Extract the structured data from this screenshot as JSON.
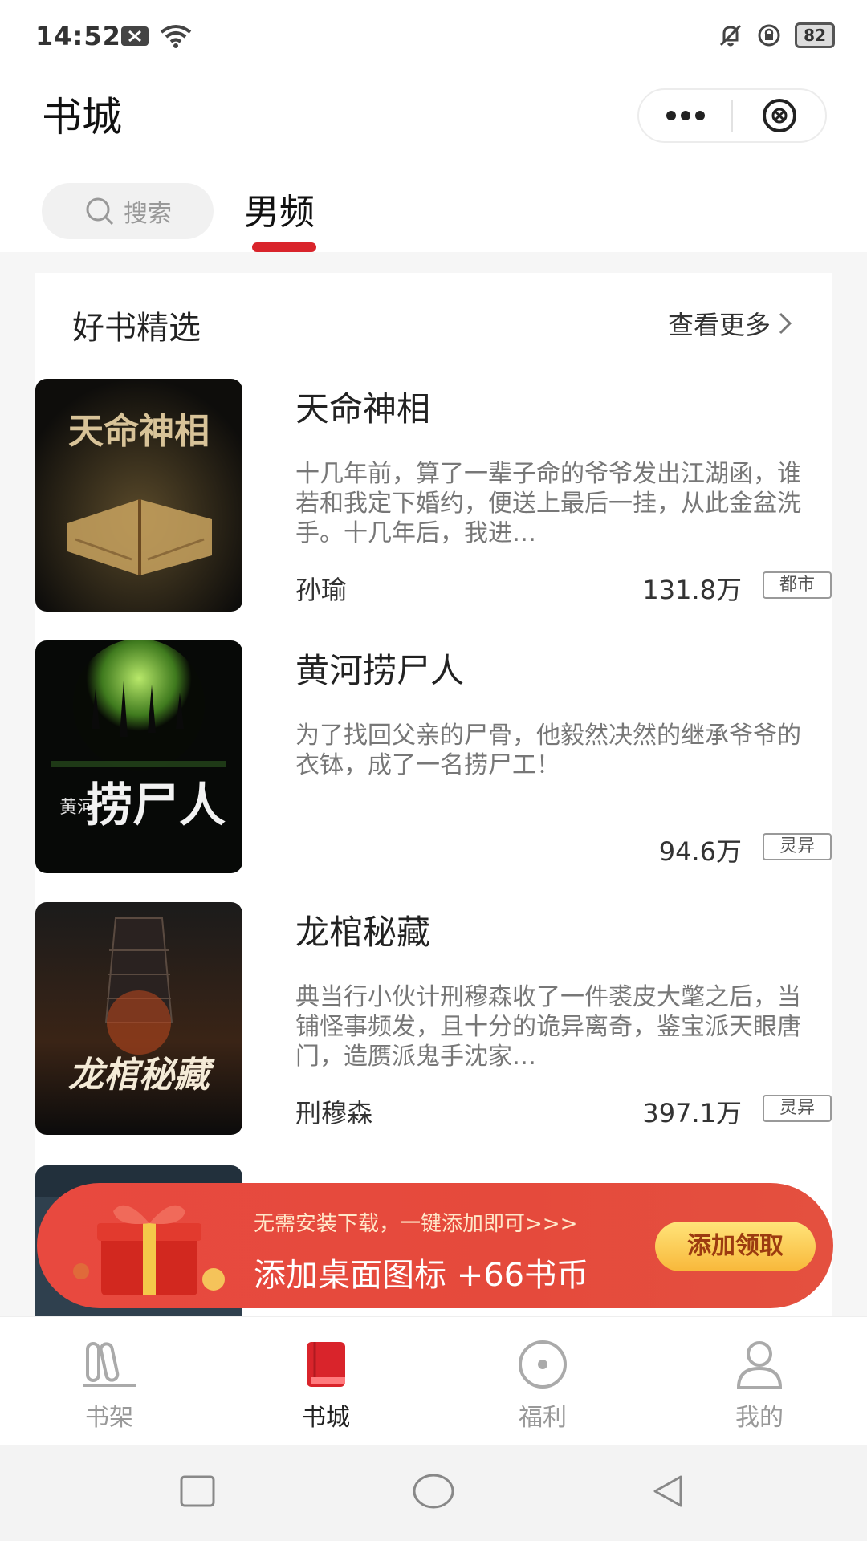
{
  "status_bar": {
    "time": "14:52",
    "battery": "82"
  },
  "header": {
    "title": "书城"
  },
  "tabs": {
    "search_placeholder": "搜索",
    "active_tab": "男频"
  },
  "section": {
    "title": "好书精选",
    "more": "查看更多"
  },
  "books": [
    {
      "title": "天命神相",
      "description": "十几年前，算了一辈子命的爷爷发出江湖函，谁若和我定下婚约，便送上最后一挂，从此金盆洗手。十几年后，我进…",
      "author": "孙瑜",
      "count": "131.8万",
      "tag": "都市",
      "cover_text": "天命神相"
    },
    {
      "title": "黄河捞尸人",
      "description": "为了找回父亲的尸骨，他毅然决然的继承爷爷的衣钵，成了一名捞尸工！",
      "author": "",
      "count": "94.6万",
      "tag": "灵异",
      "cover_text": "捞尸人",
      "cover_text_small": "黄河"
    },
    {
      "title": "龙棺秘藏",
      "description": "典当行小伙计刑穆森收了一件裘皮大氅之后，当铺怪事频发，且十分的诡异离奇，鉴宝派天眼唐门，造赝派鬼手沈家…",
      "author": "刑穆森",
      "count": "397.1万",
      "tag": "灵异",
      "cover_text": "龙棺秘藏"
    }
  ],
  "promo": {
    "line1": "无需安装下载，一键添加即可>>>",
    "line2": "添加桌面图标 +66书币",
    "button": "添加领取"
  },
  "bottom_nav": [
    {
      "label": "书架",
      "icon": "bookshelf-icon",
      "active": false
    },
    {
      "label": "书城",
      "icon": "bookstore-icon",
      "active": true
    },
    {
      "label": "福利",
      "icon": "welfare-icon",
      "active": false
    },
    {
      "label": "我的",
      "icon": "profile-icon",
      "active": false
    }
  ],
  "colors": {
    "accent": "#d9242b",
    "promo": "#e54a3c"
  }
}
